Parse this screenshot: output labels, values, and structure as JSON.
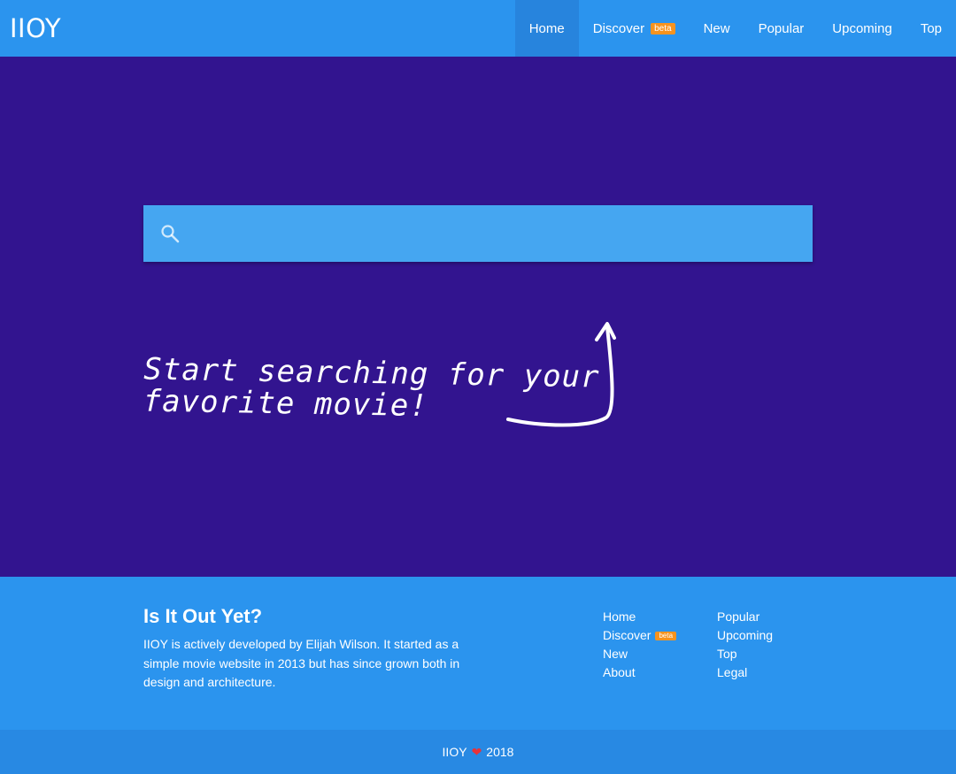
{
  "header": {
    "brand": "IIOY",
    "nav": [
      {
        "label": "Home",
        "active": true
      },
      {
        "label": "Discover",
        "badge": "beta"
      },
      {
        "label": "New"
      },
      {
        "label": "Popular"
      },
      {
        "label": "Upcoming"
      },
      {
        "label": "Top"
      }
    ]
  },
  "search": {
    "icon": "search-icon",
    "placeholder": "",
    "value": ""
  },
  "hero": {
    "hint_line1": "Start searching for your",
    "hint_line2": "favorite movie!"
  },
  "footer": {
    "title": "Is It Out Yet?",
    "text": "IIOY is actively developed by Elijah Wilson. It started as a simple movie website in 2013 but has since grown both in design and architecture.",
    "col1": [
      {
        "label": "Home"
      },
      {
        "label": "Discover",
        "badge": "beta"
      },
      {
        "label": "New"
      },
      {
        "label": "About"
      }
    ],
    "col2": [
      {
        "label": "Popular"
      },
      {
        "label": "Upcoming"
      },
      {
        "label": "Top"
      },
      {
        "label": "Legal"
      }
    ],
    "copyright_brand": "IIOY",
    "copyright_year": "2018",
    "heart_icon": "heart-icon"
  },
  "colors": {
    "primary": "#2b94ee",
    "hero_bg": "#32148f",
    "search_bg": "#45a6f1",
    "badge": "#f7931e",
    "heart": "#e8333a"
  }
}
